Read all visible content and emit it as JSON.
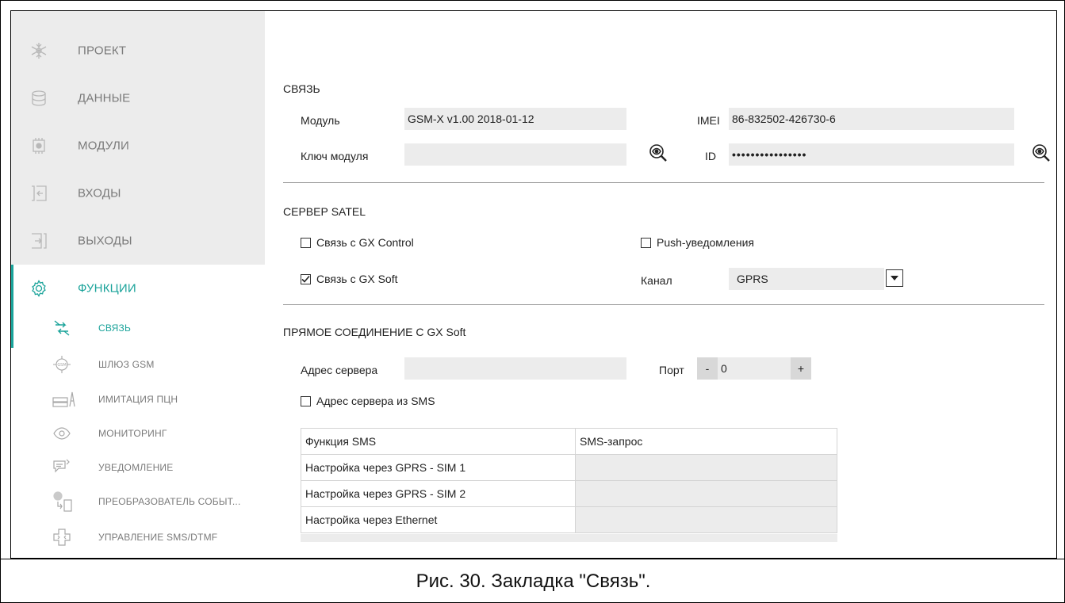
{
  "sidebar": {
    "main_items": [
      {
        "label": "ПРОЕКТ",
        "icon": "snowflake-icon"
      },
      {
        "label": "ДАННЫЕ",
        "icon": "database-icon"
      },
      {
        "label": "МОДУЛИ",
        "icon": "chip-icon"
      },
      {
        "label": "ВХОДЫ",
        "icon": "input-icon"
      },
      {
        "label": "ВЫХОДЫ",
        "icon": "output-icon"
      },
      {
        "label": "ФУНКЦИИ",
        "icon": "gear-icon"
      }
    ],
    "sub_items": [
      {
        "label": "СВЯЗЬ",
        "icon": "connection-icon"
      },
      {
        "label": "ШЛЮЗ GSM",
        "icon": "gsm-gateway-icon"
      },
      {
        "label": "ИМИТАЦИЯ ПЦН",
        "icon": "station-emulation-icon"
      },
      {
        "label": "МОНИТОРИНГ",
        "icon": "eye-icon"
      },
      {
        "label": "УВЕДОМЛЕНИЕ",
        "icon": "notification-icon"
      },
      {
        "label": "ПРЕОБРАЗОВАТЕЛЬ СОБЫТ...",
        "icon": "event-converter-icon"
      },
      {
        "label": "УПРАВЛЕНИЕ SMS/DTMF",
        "icon": "sms-control-icon"
      }
    ],
    "accent_color": "#1aa39a"
  },
  "connection": {
    "title": "СВЯЗЬ",
    "module_label": "Модуль",
    "module_value": "GSM-X v1.00 2018-01-12",
    "imei_label": "IMEI",
    "imei_value": "86-832502-426730-6",
    "key_label": "Ключ модуля",
    "key_value": "",
    "id_label": "ID",
    "id_value": "••••••••••••••••"
  },
  "satel_server": {
    "title": "СЕРВЕР SATEL",
    "gx_control_label": "Связь с GX Control",
    "gx_control_checked": false,
    "push_label": "Push-уведомления",
    "push_checked": false,
    "gx_soft_label": "Связь с GX Soft",
    "gx_soft_checked": true,
    "channel_label": "Канал",
    "channel_value": "GPRS"
  },
  "direct_connection": {
    "title": "ПРЯМОЕ СОЕДИНЕНИЕ С GX Soft",
    "server_address_label": "Адрес сервера",
    "server_address_value": "",
    "port_label": "Порт",
    "port_minus": "-",
    "port_value": "0",
    "port_plus": "+",
    "sms_address_label": "Адрес сервера из SMS",
    "sms_address_checked": false
  },
  "sms_table": {
    "headers": [
      "Функция SMS",
      "SMS-запрос"
    ],
    "rows": [
      {
        "function": "Настройка через GPRS - SIM 1",
        "request": ""
      },
      {
        "function": "Настройка через GPRS - SIM 2",
        "request": ""
      },
      {
        "function": "Настройка через Ethernet",
        "request": ""
      }
    ]
  },
  "caption": "Рис. 30. Закладка \"Связь\"."
}
